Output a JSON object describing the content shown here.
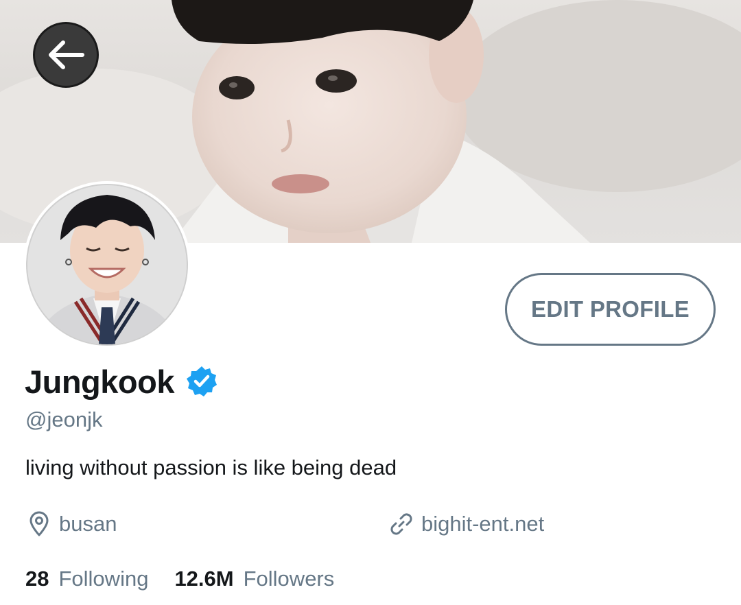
{
  "header": {
    "back_icon": "arrow-left-icon"
  },
  "profile": {
    "display_name": "Jungkook",
    "verified_icon": "verified-badge-icon",
    "handle": "@jeonjk",
    "bio": "living without passion is like being dead",
    "location": "busan",
    "location_icon": "location-pin-icon",
    "website": "bighit-ent.net",
    "website_icon": "link-icon",
    "edit_profile_label": "EDIT PROFILE"
  },
  "stats": {
    "following_count": "28",
    "following_label": "Following",
    "followers_count": "12.6M",
    "followers_label": "Followers"
  },
  "colors": {
    "text_primary": "#14171a",
    "text_secondary": "#657786",
    "verified_blue": "#1da1f2",
    "back_button_bg": "#3a3a3a"
  }
}
